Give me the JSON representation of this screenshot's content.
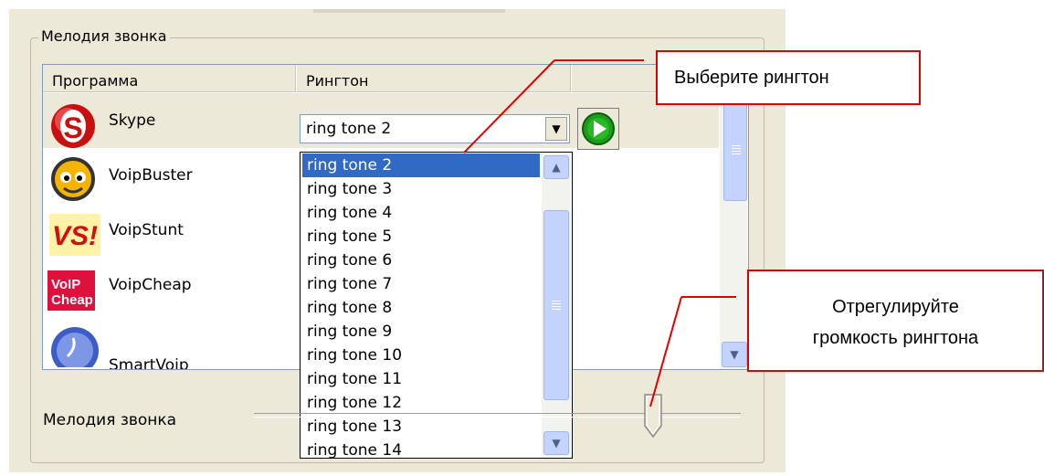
{
  "group_title": "Мелодия звонка",
  "columns": [
    "Программа",
    "Рингтон",
    ""
  ],
  "apps": [
    {
      "name": "Skype",
      "icon": "skype-icon"
    },
    {
      "name": "VoipBuster",
      "icon": "voipbuster-icon"
    },
    {
      "name": "VoipStunt",
      "icon": "voipstunt-icon"
    },
    {
      "name": "VoipCheap",
      "icon": "voipcheap-icon"
    },
    {
      "name": "SmartVoip",
      "icon": "smartvoip-icon"
    }
  ],
  "combo": {
    "value": "ring tone 2",
    "arrow_icon": "chevron-down-icon"
  },
  "play_icon": "play-icon",
  "dropdown_options": [
    "ring tone 2",
    "ring tone 3",
    "ring tone 4",
    "ring tone 5",
    "ring tone 6",
    "ring tone 7",
    "ring tone 8",
    "ring tone 9",
    "ring tone 10",
    "ring tone 11",
    "ring tone 12",
    "ring tone 13",
    "ring tone 14"
  ],
  "selected_option": "ring tone 2",
  "volume": {
    "label": "Мелодия звонка",
    "level": 0.82
  },
  "callouts": {
    "choose": "Выберите рингтон",
    "volume_line1": "Отрегулируйте",
    "volume_line2": "громкость рингтона"
  },
  "colors": {
    "callout_border": "#e00000",
    "selection": "#316ac5",
    "panel": "#ece9d8"
  }
}
